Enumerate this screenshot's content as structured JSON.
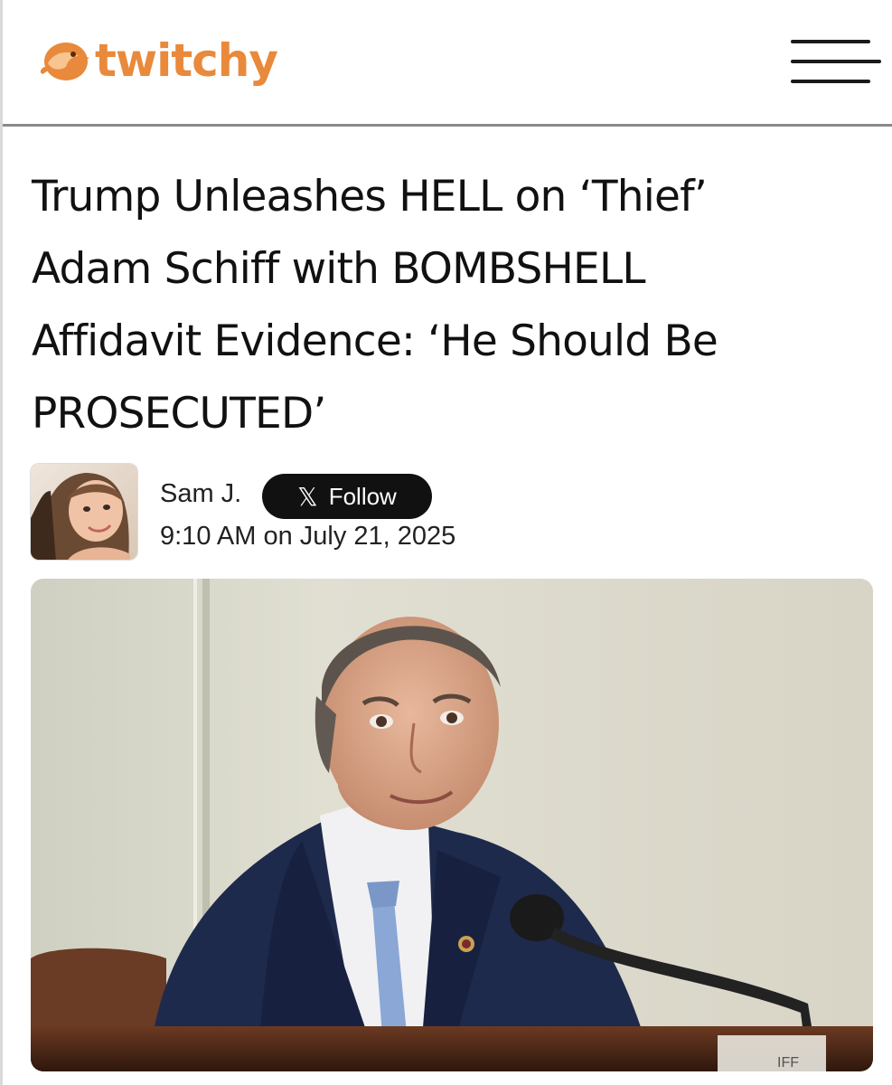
{
  "site": {
    "logo_text": "twitchy",
    "brand_color": "#e9893b",
    "logo_icon": "bird-icon",
    "menu_icon": "hamburger-menu-icon"
  },
  "article": {
    "headline_lines": [
      "Trump Unleashes HELL on ‘Thief’",
      "Adam Schiff with BOMBSHELL",
      "Affidavit Evidence: ‘He Should Be",
      "PROSECUTED’"
    ],
    "author": "Sam J.",
    "follow_label": "Follow",
    "follow_icon": "x-logo-icon",
    "timestamp": "9:10 AM on July 21, 2025"
  },
  "photo": {
    "placard_text": "IFF"
  }
}
